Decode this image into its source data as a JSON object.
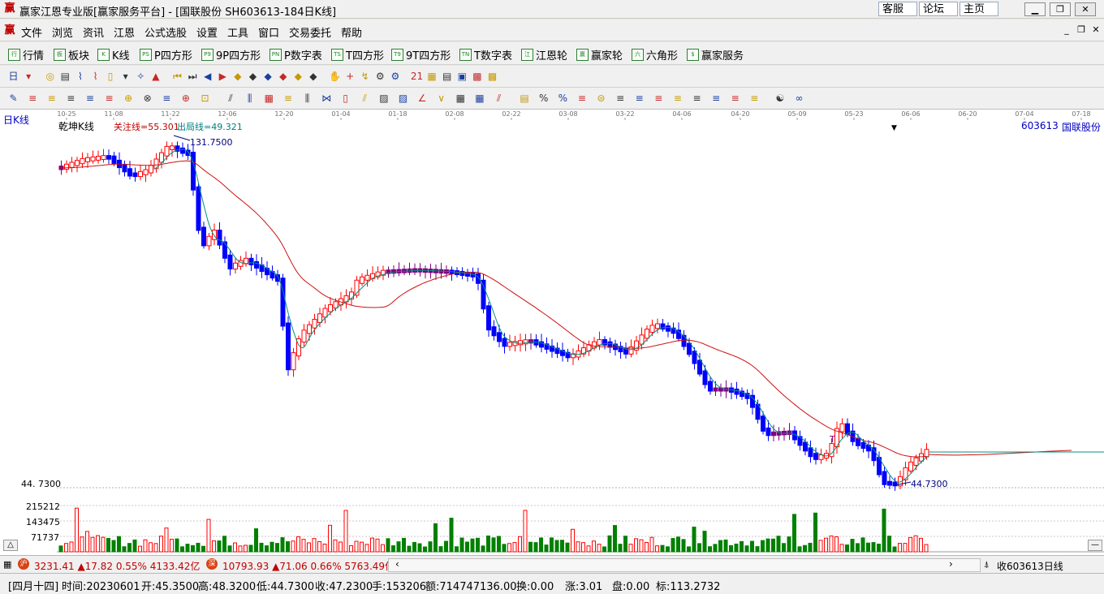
{
  "window": {
    "title": "赢家江恩专业版[赢家服务平台] - [国联股份  SH603613-184日K线]",
    "icon": "赢",
    "links": [
      "客服",
      "论坛",
      "主页"
    ]
  },
  "menu": {
    "icon": "赢",
    "items": [
      "文件",
      "浏览",
      "资讯",
      "江恩",
      "公式选股",
      "设置",
      "工具",
      "窗口",
      "交易委托",
      "帮助"
    ]
  },
  "nav": {
    "items": [
      {
        "icon": "行",
        "label": "行情"
      },
      {
        "icon": "板",
        "label": "板块"
      },
      {
        "icon": "K",
        "label": "K线"
      },
      {
        "icon": "PS",
        "label": "P四方形"
      },
      {
        "icon": "P9",
        "label": "9P四方形"
      },
      {
        "icon": "PN",
        "label": "P数字表"
      },
      {
        "icon": "TS",
        "label": "T四方形"
      },
      {
        "icon": "T9",
        "label": "9T四方形"
      },
      {
        "icon": "TN",
        "label": "T数字表"
      },
      {
        "icon": "江",
        "label": "江恩轮"
      },
      {
        "icon": "赢",
        "label": "赢家轮"
      },
      {
        "icon": "六",
        "label": "六角形"
      },
      {
        "icon": "$",
        "label": "赢家服务"
      }
    ]
  },
  "toolbar1_icons": [
    "日",
    "▾",
    "◎",
    "▤",
    "⌇",
    "⌇",
    "▯",
    "▾",
    "✧",
    "▲",
    "⏮",
    "⏭",
    "◀",
    "▶",
    "◆",
    "◆",
    "◆",
    "◆",
    "◆",
    "◆",
    "✋",
    "+",
    "↯",
    "⚙",
    "⚙",
    "21",
    "▦",
    "▤",
    "▣",
    "▩",
    "▩"
  ],
  "toolbar2_icons": [
    "✎",
    "≡",
    "≡",
    "≡",
    "≡",
    "≡",
    "⊕",
    "⊗",
    "≡",
    "⊕",
    "⊡",
    "⫽",
    "⫼",
    "▦",
    "≡",
    "⫼",
    "⋈",
    "▯",
    "⫽",
    "▨",
    "▨",
    "∠",
    "∨",
    "▦",
    "▦",
    "⫽",
    "▤",
    "%",
    "%",
    "≡",
    "⊜",
    "≡",
    "≡",
    "≡",
    "≡",
    "≡",
    "≡",
    "≡",
    "≡",
    "☯",
    "∞"
  ],
  "chart": {
    "period_label": "日K线",
    "kline_name": "乾坤K线",
    "watch_line": "关注线=55.301",
    "exit_line": "出局线=49.321",
    "stock_code": "603613",
    "stock_name": "国联股份",
    "high_label": "131.7500",
    "low_label": "44.7300",
    "marker_t": "T",
    "date_ticks": [
      "10-25",
      "11-08",
      "11-22",
      "12-06",
      "12-20",
      "01-04",
      "01-18",
      "02-08",
      "02-22",
      "03-08",
      "03-22",
      "04-06",
      "04-20",
      "05-09",
      "05-23",
      "06-06",
      "06-20",
      "07-04",
      "07-18"
    ],
    "price_axis_label": "44. 7300",
    "volume_axis_labels": [
      "215212",
      "143475",
      "71737"
    ]
  },
  "scroll": {
    "index1": "3231.41 ▲17.82 0.55% 4133.42亿",
    "index2": "10793.93 ▲71.06 0.66% 5763.49亿",
    "input_label": "收603613日线"
  },
  "status": {
    "lunar": "[四月十四]",
    "time": "时间:20230601",
    "open": "开:45.3500",
    "high": "高:48.3200",
    "low": "低:44.7300",
    "close": "收:47.2300",
    "hands": "手:153206",
    "amount": "额:714747136.00",
    "turnover": "换:0.00",
    "change": "涨:3.01",
    "disk": "盘:0.00",
    "mark": "标:113.2732"
  },
  "colors": {
    "up": "#ff0000",
    "down": "#0000ff",
    "neutral": "#800080",
    "ma_slow": "#d01010",
    "ma_fast": "#009080",
    "volume_down": "#008000"
  }
}
